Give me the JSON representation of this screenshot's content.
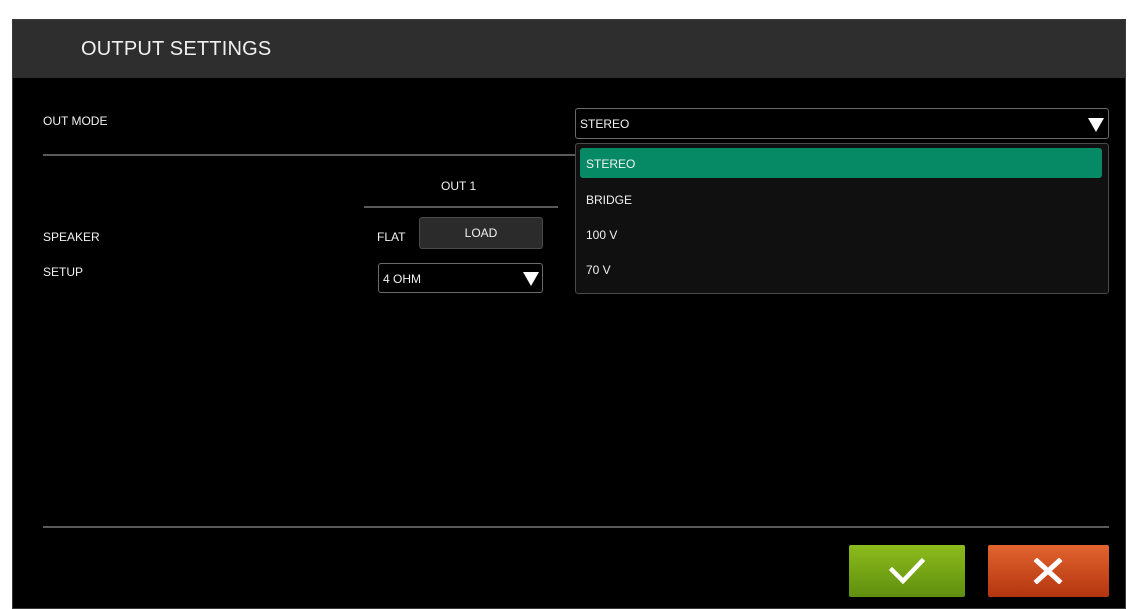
{
  "dialog": {
    "title": "OUTPUT SETTINGS",
    "out_mode_label": "OUT MODE",
    "out_mode_value": "STEREO",
    "out_mode_options": [
      "STEREO",
      "BRIDGE",
      "100 V",
      "70 V"
    ],
    "column_header": "OUT 1",
    "speaker_label": "SPEAKER",
    "setup_label": "SETUP",
    "eq_value": "FLAT",
    "load_button_label": "LOAD",
    "impedance_value": "4 OHM"
  },
  "colors": {
    "selected_option": "#058a65",
    "confirm_button": "#8cbb1c",
    "cancel_button": "#d24f21"
  },
  "icons": {
    "confirm": "checkmark-icon",
    "cancel": "close-x-icon",
    "dropdown": "caret-down-icon"
  }
}
